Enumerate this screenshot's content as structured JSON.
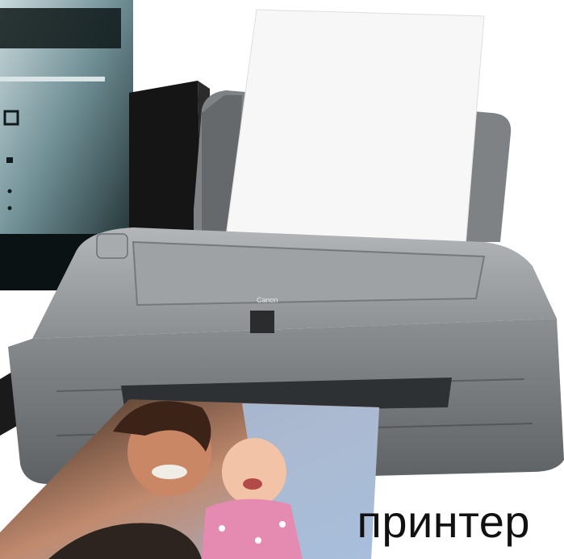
{
  "image": {
    "caption": "принтер",
    "brand_mark": "Canon",
    "colors": {
      "printer_body": "#8f9396",
      "printer_dark": "#5e6265",
      "monitor": "#1d2a2c",
      "paper": "#f7f7f7",
      "photo_sky": "#9fb6d8"
    }
  }
}
